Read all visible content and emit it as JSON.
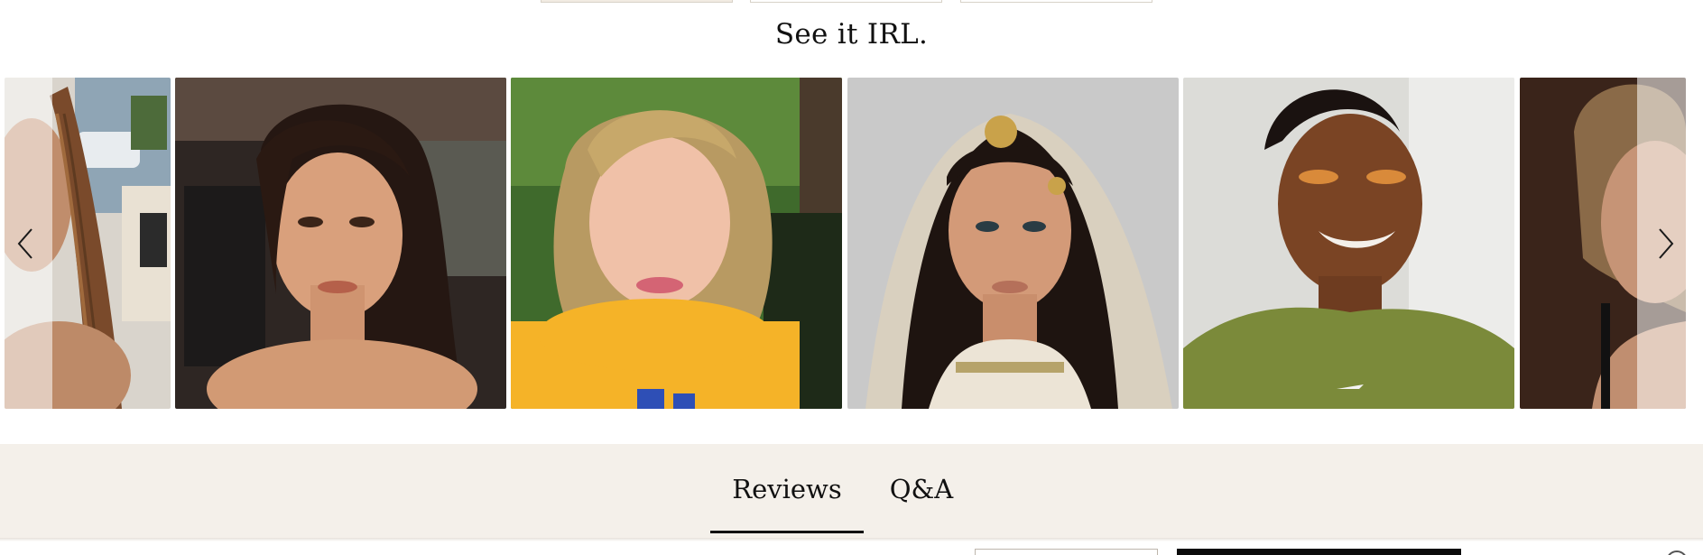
{
  "section": {
    "title": "See it IRL."
  },
  "carousel": {
    "prev_icon": "chevron-left-icon",
    "next_icon": "chevron-right-icon",
    "photos": [
      {
        "name": "ugc-photo-braids"
      },
      {
        "name": "ugc-photo-bronze-glam"
      },
      {
        "name": "ugc-photo-curly-blonde"
      },
      {
        "name": "ugc-photo-bridal"
      },
      {
        "name": "ugc-photo-smile-green-top"
      },
      {
        "name": "ugc-photo-curly-partial"
      }
    ]
  },
  "tabs": {
    "reviews_label": "Reviews",
    "qa_label": "Q&A",
    "active": "Reviews"
  },
  "colors": {
    "band_background": "#f4f0ea",
    "text": "#111111",
    "active_underline": "#111111"
  }
}
